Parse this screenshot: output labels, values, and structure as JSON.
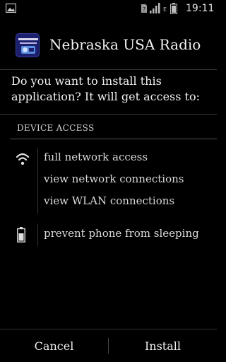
{
  "status_bar": {
    "time": "19:11",
    "network_type": "E",
    "icons": [
      "image-icon",
      "sim-icon",
      "signal-icon",
      "battery-icon"
    ]
  },
  "header": {
    "app_name": "Nebraska USA Radio",
    "app_icon": "radio-app-icon"
  },
  "prompt": {
    "question": "Do you want to install this application? It will get access to:"
  },
  "permissions": {
    "section_title": "DEVICE ACCESS",
    "groups": [
      {
        "icon": "wifi-icon",
        "items": [
          "full network access",
          "view network connections",
          "view WLAN connections"
        ]
      },
      {
        "icon": "battery-icon",
        "items": [
          "prevent phone from sleeping"
        ]
      }
    ]
  },
  "actions": {
    "cancel_label": "Cancel",
    "install_label": "Install"
  }
}
